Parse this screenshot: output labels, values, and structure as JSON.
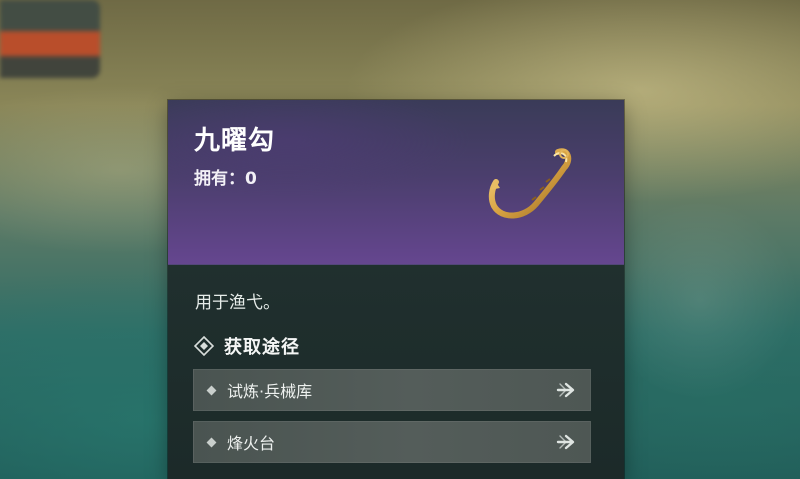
{
  "item": {
    "name": "九曜勾",
    "owned_label": "拥有：0",
    "icon": "golden-fish-hook-icon",
    "description": "用于渔弋。"
  },
  "acquire": {
    "title": "获取途径",
    "routes": [
      {
        "label": "试炼·兵械库",
        "icon": "arrow-right-icon"
      },
      {
        "label": "烽火台",
        "icon": "arrow-right-icon"
      }
    ]
  },
  "colors": {
    "header_purple": "#65468f",
    "card_bg": "#1c2a29",
    "route_bg": "#545d5a",
    "hook_gold": "#d9a443"
  }
}
